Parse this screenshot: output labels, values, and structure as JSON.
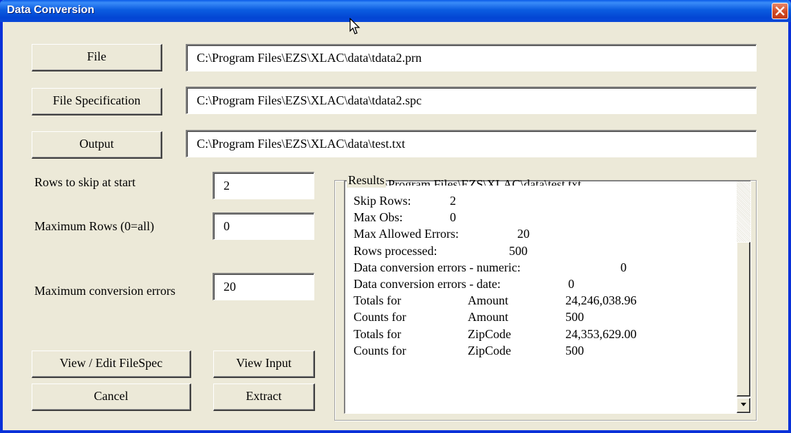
{
  "window": {
    "title": "Data Conversion"
  },
  "files": {
    "file_button": "File",
    "file_value": "C:\\Program Files\\EZS\\XLAC\\data\\tdata2.prn",
    "spec_button": "File Specification",
    "spec_value": "C:\\Program Files\\EZS\\XLAC\\data\\tdata2.spc",
    "output_button": "Output",
    "output_value": "C:\\Program Files\\EZS\\XLAC\\data\\test.txt"
  },
  "options": {
    "rows_skip_label": "Rows to skip at start",
    "rows_skip_value": "2",
    "max_rows_label": "Maximum Rows (0=all)",
    "max_rows_value": "0",
    "max_errors_label": "Maximum conversion errors",
    "max_errors_value": "20"
  },
  "buttons": {
    "view_edit": "View / Edit FileSpec",
    "view_input": "View Input",
    "cancel": "Cancel",
    "extract": "Extract"
  },
  "results": {
    "group_title": "Results",
    "overflow_line": "... C:\\Program Files\\EZS\\XLAC\\data\\test.txt",
    "lines": [
      {
        "label": "Skip Rows:",
        "value": "2"
      },
      {
        "label": "Max Obs:",
        "value": "0"
      },
      {
        "label": "Max Allowed Errors:",
        "value": "20"
      },
      {
        "label": "Rows processed:",
        "value": "500"
      },
      {
        "label": "Data conversion errors - numeric:",
        "value": "0"
      },
      {
        "label": "Data conversion errors - date:",
        "value": "0"
      },
      {
        "label": "Totals for",
        "field": "Amount",
        "value": "24,246,038.96"
      },
      {
        "label": "Counts for",
        "field": "Amount",
        "value": "500"
      },
      {
        "label": "Totals for",
        "field": "ZipCode",
        "value": "24,353,629.00"
      },
      {
        "label": "Counts for",
        "field": "ZipCode",
        "value": "500"
      }
    ]
  },
  "icons": {
    "close": "close-icon",
    "cursor": "mouse-cursor-icon",
    "scroll_down": "scroll-down-arrow-icon"
  }
}
